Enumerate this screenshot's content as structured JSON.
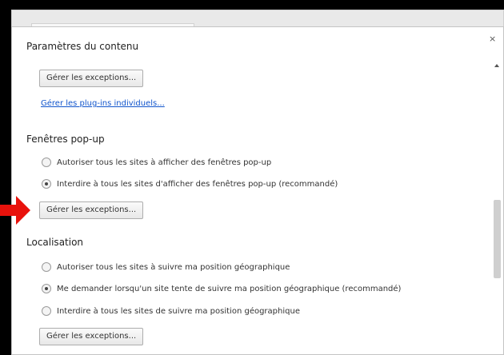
{
  "dialog": {
    "title": "Paramètres du contenu",
    "close_glyph": "×"
  },
  "top_section": {
    "manage_exceptions_label": "Gérer les exceptions...",
    "plugins_link": "Gérer les plug-ins individuels..."
  },
  "popups": {
    "heading": "Fenêtres pop-up",
    "options": [
      {
        "label": "Autoriser tous les sites à afficher des fenêtres pop-up",
        "checked": false
      },
      {
        "label": "Interdire à tous les sites d'afficher des fenêtres pop-up (recommandé)",
        "checked": true
      }
    ],
    "manage_exceptions_label": "Gérer les exceptions..."
  },
  "location": {
    "heading": "Localisation",
    "options": [
      {
        "label": "Autoriser tous les sites à suivre ma position géographique",
        "checked": false
      },
      {
        "label": "Me demander lorsqu'un site tente de suivre ma position géographique (recommandé)",
        "checked": true
      },
      {
        "label": "Interdire à tous les sites de suivre ma position géographique",
        "checked": false
      }
    ],
    "manage_exceptions_label": "Gérer les exceptions..."
  },
  "colors": {
    "annotation_arrow": "#e8120c",
    "link": "#1155cc"
  },
  "icons": {
    "close": "close-icon",
    "annotation": "red-arrow-icon"
  }
}
